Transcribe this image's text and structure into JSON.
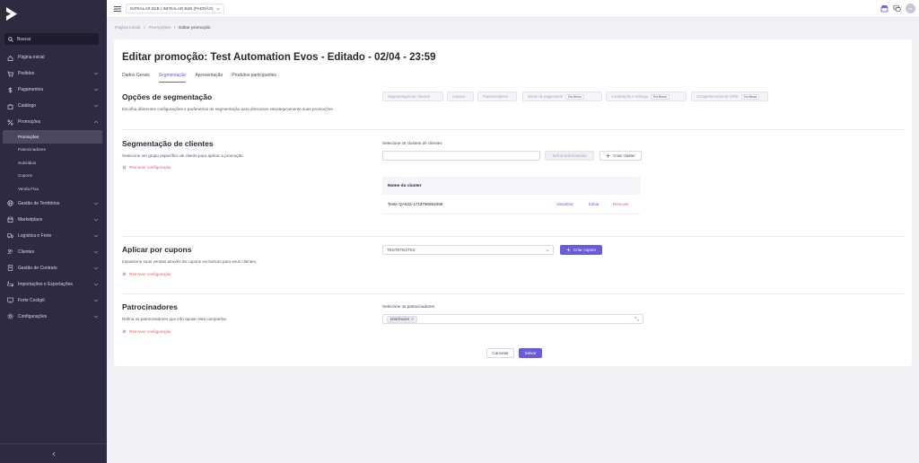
{
  "sidebar": {
    "search_label": "Buscar",
    "items": [
      {
        "label": "Página inicial",
        "icon": "home-icon"
      },
      {
        "label": "Pedidos",
        "icon": "cart-icon",
        "chevron": true
      },
      {
        "label": "Pagamentos",
        "icon": "dollar-icon",
        "chevron": true
      },
      {
        "label": "Catálogo",
        "icon": "bag-icon",
        "chevron": true
      },
      {
        "label": "Promoções",
        "icon": "percent-icon",
        "chevron": true,
        "expanded": true
      }
    ],
    "sub_items": [
      {
        "label": "Promoções",
        "active": true
      },
      {
        "label": "Patrocinadores"
      },
      {
        "label": "Subsídios"
      },
      {
        "label": "Cupons"
      },
      {
        "label": "Venda Fixa"
      }
    ],
    "items_after": [
      {
        "label": "Gestão de Territórios",
        "icon": "globe-icon"
      },
      {
        "label": "Marketplace",
        "icon": "store-icon"
      },
      {
        "label": "Logística e Frete",
        "icon": "truck-icon"
      },
      {
        "label": "Clientes",
        "icon": "users-icon"
      },
      {
        "label": "Gestão de Contrato",
        "icon": "contract-icon"
      },
      {
        "label": "Importações e Exportações",
        "icon": "import-export-icon"
      },
      {
        "label": "Forte Cockpit",
        "icon": "cockpit-icon"
      },
      {
        "label": "Configurações",
        "icon": "gear-icon"
      }
    ]
  },
  "topbar": {
    "tenant": "INFRALAR B2B / INFRALAR B2B (PADRÃO)",
    "avatar_initials": "AL"
  },
  "breadcrumb": [
    "Página inicial",
    "/",
    "Promoções",
    "/",
    "Editar promoção"
  ],
  "page": {
    "title": "Editar promoção: Test Automation Evos - Editado - 02/04 - 23:59",
    "tabs": [
      "Dados Gerais",
      "Segmentação",
      "Apresentação",
      "Produtos participantes"
    ],
    "active_tab": 1
  },
  "segmentation_options": {
    "title": "Opções de segmentação",
    "desc": "Escolha diferentes configurações e parâmetros de segmentação para direcionar estrategicamente suas promoções.",
    "chips": [
      {
        "label": "Segmentação de clientes"
      },
      {
        "label": "Cupons"
      },
      {
        "label": "Patrocinadores"
      },
      {
        "label": "Meios de pagamento",
        "badge": "Em Breve"
      },
      {
        "label": "Localização e entrega",
        "badge": "Em Breve"
      },
      {
        "label": "Comportamento de CRM",
        "badge": "Em Breve"
      }
    ]
  },
  "client_segmentation": {
    "title": "Segmentação de clientes",
    "desc": "Selecione um grupo específico de cliente para aplicar a promoção.",
    "remove": "Remover configuração",
    "field_label": "Selecione os clusters de clientes",
    "add_selected": "Incluir selecionados",
    "create_cluster": "Criar cluster",
    "table_header": "Nome do cluster",
    "rows": [
      {
        "name": "Teste QA523-1743786854088",
        "view": "Visualizar",
        "edit": "Editar",
        "remove": "Remover"
      }
    ]
  },
  "coupons": {
    "title": "Aplicar por cupons",
    "desc": "Impulsione suas vendas através de cupons exclusivos para seus clientes.",
    "remove": "Remover configuração",
    "selected": "TESTETESTE2",
    "create": "Criar cupom"
  },
  "sponsors": {
    "title": "Patrocinadores",
    "desc": "Defina os patrocinadores que irão apoiar esta campanha.",
    "remove": "Remover configuração",
    "field_label": "Selecione os patrocinadores",
    "tag": "Distribuidor"
  },
  "footer": {
    "cancel": "Cancelar",
    "save": "Salvar"
  },
  "colors": {
    "accent": "#6b5bd6",
    "sidebar": "#2f2a40",
    "danger": "#e05a6a"
  }
}
